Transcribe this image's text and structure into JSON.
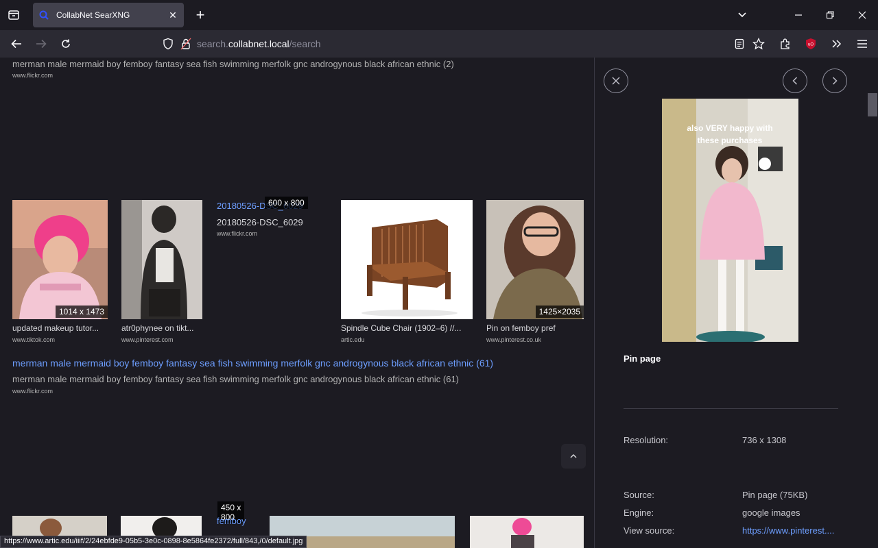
{
  "browser": {
    "tab_title": "CollabNet SearXNG",
    "url_prefix": "search.",
    "url_domain": "collabnet.local",
    "url_path": "/search"
  },
  "results": {
    "top_desc": "merman male mermaid boy femboy fantasy sea fish swimming merfolk gnc androgynous black african ethnic (2)",
    "top_site": "www.flickr.com",
    "row1": [
      {
        "caption": "updated makeup tutor...",
        "site": "www.tiktok.com",
        "dim": "1014 x 1473"
      },
      {
        "caption": "atr0phynee on tikt...",
        "site": "www.pinterest.com",
        "dim": ""
      },
      {
        "title": "20180526-DSC_6029",
        "caption": "20180526-DSC_6029",
        "site": "www.flickr.com",
        "dim": "600 x 800"
      },
      {
        "caption": "Spindle Cube Chair (1902–6) //...",
        "site": "artic.edu",
        "dim": ""
      },
      {
        "caption": "Pin on femboy pref",
        "site": "www.pinterest.co.uk",
        "dim": "1425×2035"
      }
    ],
    "mid_title": "merman male mermaid boy femboy fantasy sea fish swimming merfolk gnc androgynous black african ethnic (61)",
    "mid_desc": "merman male mermaid boy femboy fantasy sea fish swimming merfolk gnc androgynous black african ethnic (61)",
    "mid_site": "www.flickr.com",
    "bottom_dim": "450 x\n800",
    "bottom_link": "femboy"
  },
  "detail": {
    "image_text": "also VERY happy with these purchases",
    "page_label": "Pin page",
    "resolution_label": "Resolution:",
    "resolution_value": "736 x 1308",
    "source_label": "Source:",
    "source_value": "Pin page (75KB)",
    "engine_label": "Engine:",
    "engine_value": "google images",
    "view_source_label": "View source:",
    "view_source_value": "https://www.pinterest...."
  },
  "status_url": "https://www.artic.edu/iiif/2/24ebfde9-05b5-3e0c-0898-8e5864fe2372/full/843,/0/default.jpg"
}
